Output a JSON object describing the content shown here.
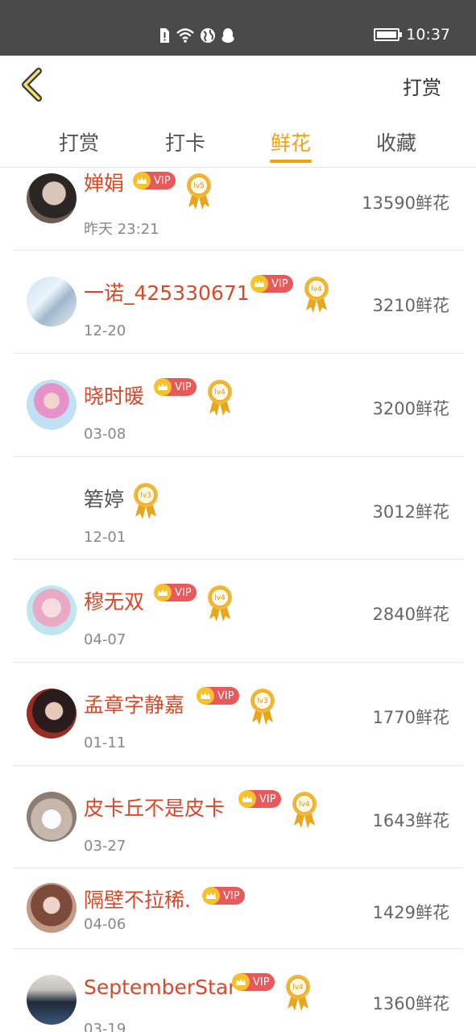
{
  "status_bar": {
    "time": "10:37"
  },
  "header": {
    "right_label": "打赏"
  },
  "tabs": [
    {
      "label": "打赏",
      "active": false
    },
    {
      "label": "打卡",
      "active": false
    },
    {
      "label": "鲜花",
      "active": true
    },
    {
      "label": "收藏",
      "active": false
    }
  ],
  "list": [
    {
      "name": "婵娟",
      "time": "昨天 23:21",
      "amount": "13590鲜花",
      "vip": "VIP",
      "level": "lv5",
      "avatar": "avatar-1"
    },
    {
      "name": "一诺_425330671",
      "time": "12-20",
      "amount": "3210鲜花",
      "vip": "VIP",
      "level": "lv4",
      "avatar": "avatar-2"
    },
    {
      "name": "晓时暖",
      "time": "03-08",
      "amount": "3200鲜花",
      "vip": "VIP",
      "level": "lv4",
      "avatar": "avatar-3"
    },
    {
      "name": "箬婷",
      "time": "12-01",
      "amount": "3012鲜花",
      "vip": "",
      "level": "lv3",
      "avatar": ""
    },
    {
      "name": "穆无双",
      "time": "04-07",
      "amount": "2840鲜花",
      "vip": "VIP",
      "level": "lv4",
      "avatar": "avatar-5"
    },
    {
      "name": "孟章字静嘉",
      "time": "01-11",
      "amount": "1770鲜花",
      "vip": "VIP",
      "level": "lv3",
      "avatar": "avatar-6"
    },
    {
      "name": "皮卡丘不是皮卡",
      "time": "03-27",
      "amount": "1643鲜花",
      "vip": "VIP",
      "level": "lv4",
      "avatar": "avatar-7"
    },
    {
      "name": "隔壁不拉稀.",
      "time": "04-06",
      "amount": "1429鲜花",
      "vip": "VIP",
      "level": "",
      "avatar": "avatar-8"
    },
    {
      "name": "SeptemberStar",
      "time": "03-19",
      "amount": "1360鲜花",
      "vip": "VIP",
      "level": "lv4",
      "avatar": "avatar-9"
    }
  ],
  "colors": {
    "accent": "#f5a000",
    "name_red": "#d9482a",
    "vip_red": "#e9585a",
    "gold": "#f6c12a"
  }
}
